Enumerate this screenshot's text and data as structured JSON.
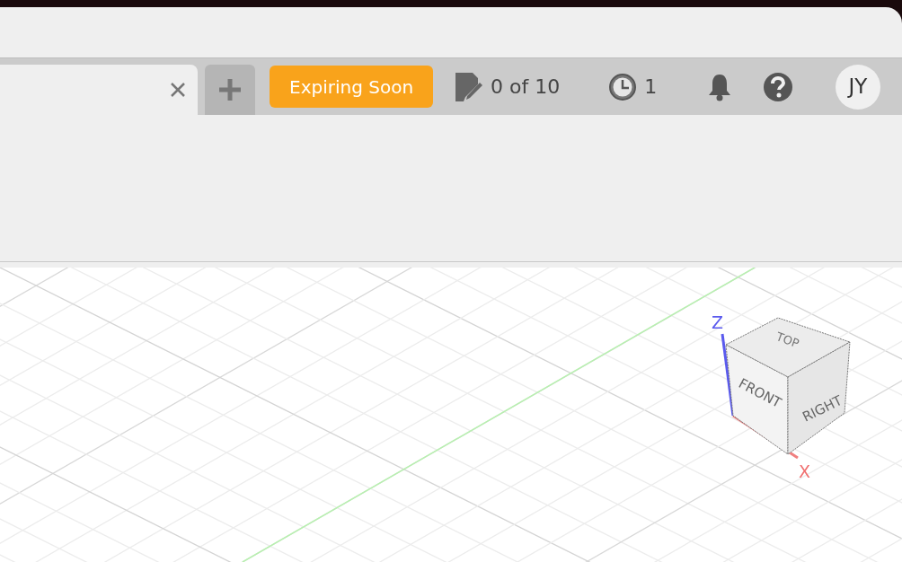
{
  "tab": {
    "selected": true
  },
  "expiring_button": {
    "label": "Expiring Soon"
  },
  "documents_count": {
    "text": "0 of 10"
  },
  "jobs_count": {
    "text": "1"
  },
  "avatar": {
    "initials": "JY"
  },
  "viewcube": {
    "faces": [
      "TOP",
      "FRONT",
      "RIGHT"
    ],
    "axes": [
      "Z",
      "X"
    ]
  }
}
